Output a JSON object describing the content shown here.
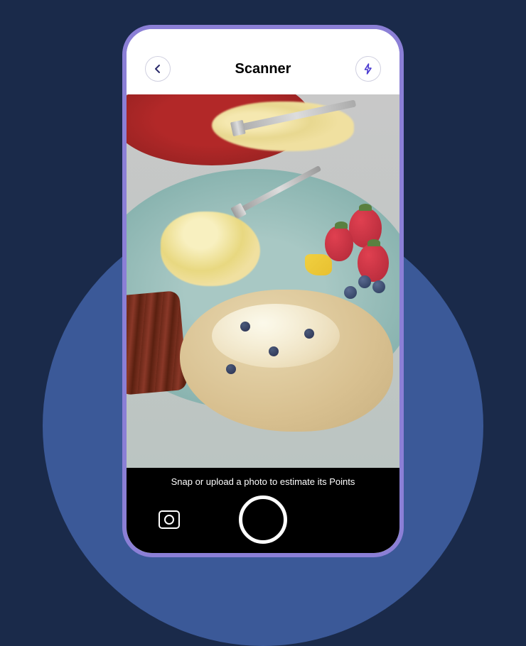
{
  "header": {
    "title": "Scanner",
    "back_icon": "arrow-left",
    "flash_icon": "lightning-bolt"
  },
  "camera": {
    "hint_text": "Snap or upload a photo to estimate its Points"
  }
}
